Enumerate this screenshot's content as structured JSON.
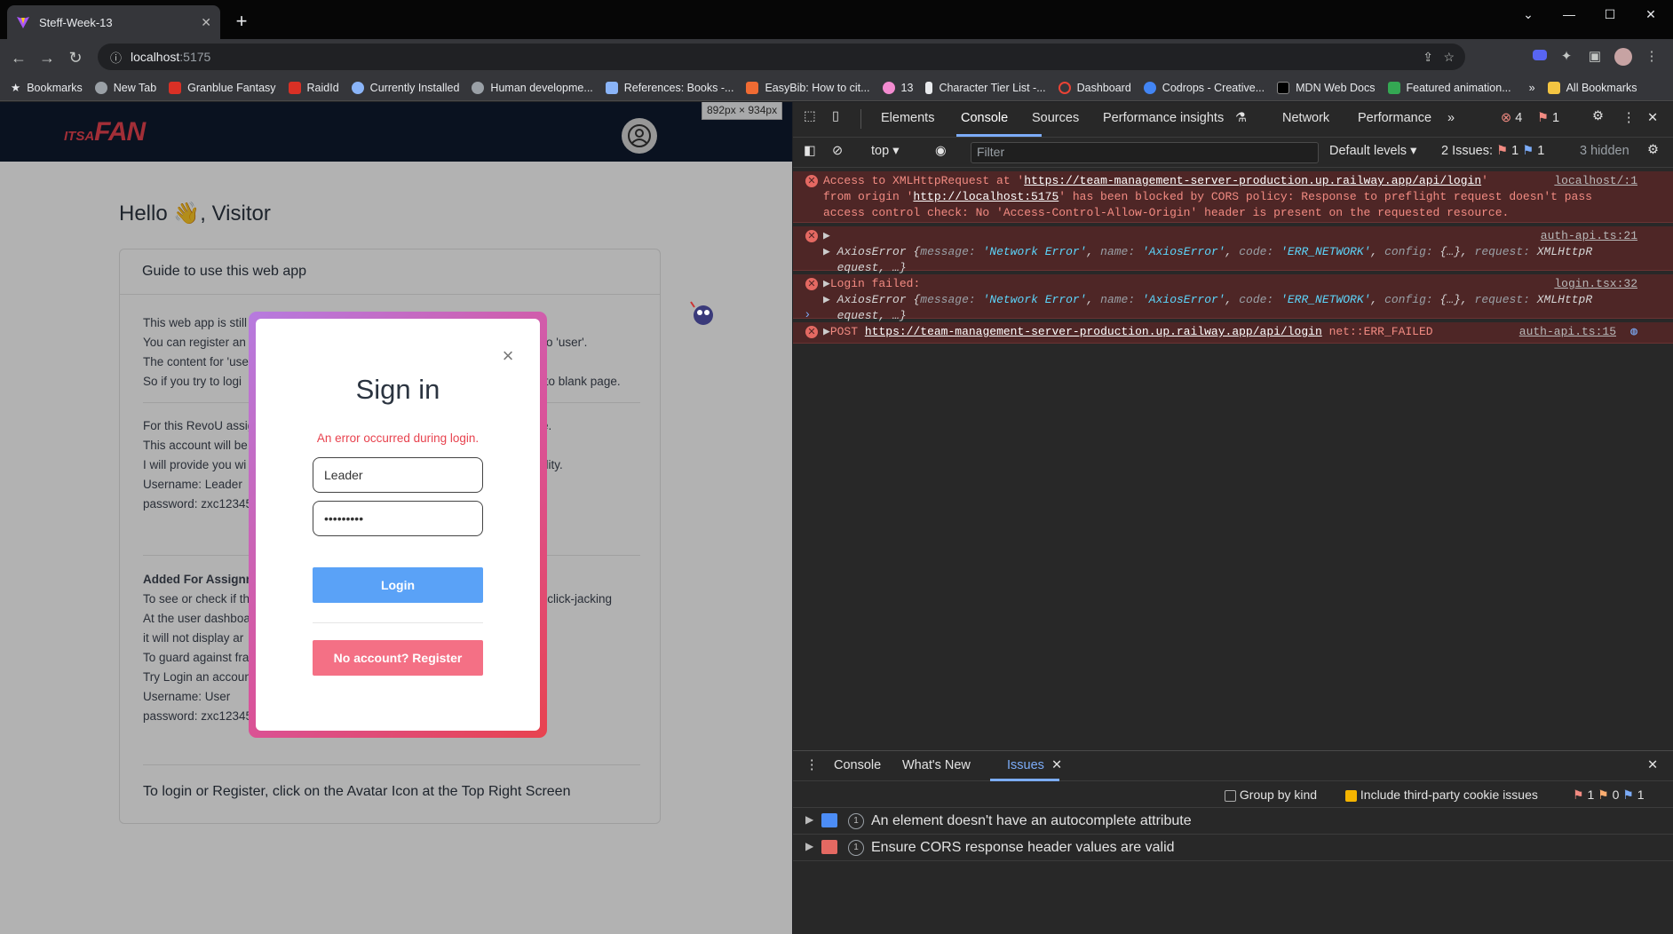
{
  "browser": {
    "tab_title": "Steff-Week-13",
    "url_host": "localhost",
    "url_port": ":5175",
    "bookmarks": [
      {
        "label": "Bookmarks",
        "color": "#e8eaed"
      },
      {
        "label": "New Tab",
        "color": "#9aa0a6"
      },
      {
        "label": "Granblue Fantasy",
        "color": "#d93025"
      },
      {
        "label": "RaidId",
        "color": "#d93025"
      },
      {
        "label": "Currently Installed",
        "color": "#8ab4f8"
      },
      {
        "label": "Human developme...",
        "color": "#9aa0a6"
      },
      {
        "label": "References: Books -...",
        "color": "#8ab4f8"
      },
      {
        "label": "EasyBib: How to cit...",
        "color": "#f06b33"
      },
      {
        "label": "13",
        "color": "#f28bd0"
      },
      {
        "label": "Character Tier List -...",
        "color": "#e8eaed"
      },
      {
        "label": "Dashboard",
        "color": "#ea4335"
      },
      {
        "label": "Codrops - Creative...",
        "color": "#4285f4"
      },
      {
        "label": "MDN Web Docs",
        "color": "#e8eaed"
      },
      {
        "label": "Featured animation...",
        "color": "#34a853"
      }
    ],
    "more_bookmarks": "»",
    "all_bookmarks": "All Bookmarks"
  },
  "page": {
    "size_badge": "892px × 934px",
    "logo_small": "ITSA",
    "logo_big": "FAN",
    "greeting": "Hello 👋, Visitor",
    "guide_title": "Guide to use this web app",
    "guide_lines_1": [
      "This web app is still",
      "You can register an",
      "The content for 'use",
      "So if you try to logi"
    ],
    "guide_lines_1_right": [
      "o 'user'.",
      "ed to blank page."
    ],
    "guide_lines_2": [
      "For this RevoU assig",
      "This account will be",
      "I will provide you wi",
      "Username: Leader",
      "password: zxc12345"
    ],
    "guide_lines_2_right": [
      "le.",
      "ality."
    ],
    "section_title": "Added For Assignm",
    "guide_lines_3": [
      "To see or check if th",
      "At the user dashboa",
      "it will not display ar",
      "To guard against fra",
      "Try Login an accoun",
      "Username: User",
      "password: zxc12345"
    ],
    "guide_lines_3_right": "e click-jacking",
    "footer_hint": "To login or Register, click on the Avatar Icon at the Top Right Screen"
  },
  "modal": {
    "title": "Sign in",
    "error": "An error occurred during login.",
    "username_value": "Leader",
    "password_value": "•••••••••",
    "login_label": "Login",
    "register_label": "No account? Register"
  },
  "devtools": {
    "tabs": [
      "Elements",
      "Console",
      "Sources",
      "Performance insights",
      "Network",
      "Performance"
    ],
    "error_count": "4",
    "issue_count": "1",
    "context": "top",
    "filter_placeholder": "Filter",
    "levels": "Default levels",
    "issues_label": "2 Issues:",
    "issues_red": "1",
    "issues_blue": "1",
    "hidden": "3 hidden",
    "messages": {
      "cors": {
        "line1_pre": "Access to XMLHttpRequest at '",
        "line1_url": "https://team-management-server-production.up.railway.app/api/login",
        "line1_post": "'",
        "line2_pre": "from origin '",
        "line2_url": "http://localhost:5175",
        "line2_post": "' has been blocked by CORS policy: Response to preflight request doesn't pass",
        "line3": "access control check: No 'Access-Control-Allow-Origin' header is present on the requested resource.",
        "source": "localhost/:1"
      },
      "axios1": {
        "source": "auth-api.ts:21",
        "name": "AxiosError",
        "k1": "message:",
        "v1": "'Network Error'",
        "k2": "name:",
        "v2": "'AxiosError'",
        "k3": "code:",
        "v3": "'ERR_NETWORK'",
        "k4": "config:",
        "v4": "{…}",
        "k5": "request:",
        "v5a": "XMLHttpR",
        "v5b": "equest, …}"
      },
      "login_failed": {
        "label": "Login failed:",
        "source": "login.tsx:32"
      },
      "post": {
        "method": "POST",
        "url": "https://team-management-server-production.up.railway.app/api/login",
        "status": "net::ERR_FAILED",
        "source": "auth-api.ts:15"
      }
    },
    "drawer_tabs": [
      "Console",
      "What's New",
      "Issues"
    ],
    "group_by_kind": "Group by kind",
    "include_third_party": "Include third-party cookie issues",
    "counts": {
      "red": "1",
      "orange": "0",
      "blue": "1"
    },
    "issues": [
      {
        "count": "1",
        "text": "An element doesn't have an autocomplete attribute",
        "color": "#4c8df6"
      },
      {
        "count": "1",
        "text": "Ensure CORS response header values are valid",
        "color": "#e46962"
      }
    ]
  }
}
